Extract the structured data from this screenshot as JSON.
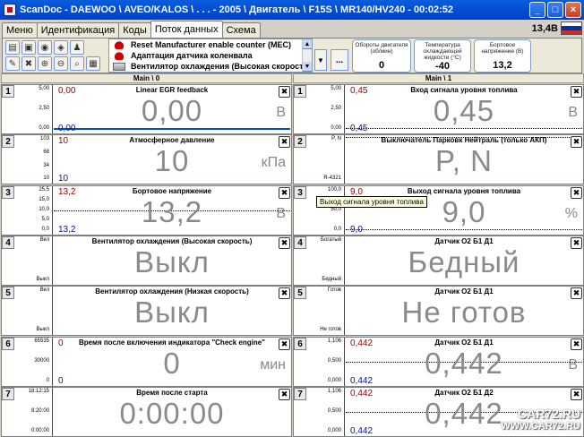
{
  "window": {
    "title": "ScanDoc - DAEWOO \\ AVEO/KALOS \\ . . . - 2005 \\ Двигатель \\ F15S \\ MR140/HV240 - 00:02:52",
    "min": "_",
    "max": "□",
    "close": "×"
  },
  "tabs": [
    {
      "label": "Меню",
      "active": false
    },
    {
      "label": "Идентификация",
      "active": false
    },
    {
      "label": "Коды",
      "active": false
    },
    {
      "label": "Поток данных",
      "active": true
    },
    {
      "label": "Схема",
      "active": false
    }
  ],
  "status": {
    "voltage": "13,4В",
    "flag_colors": [
      "#ffffff",
      "#0033a0",
      "#d52b1e"
    ]
  },
  "toolbar": {
    "params": [
      {
        "label": "Reset Manufacturer enable counter (MEC)",
        "icon": "red-car-icon"
      },
      {
        "label": "Адаптация датчика коленвала",
        "icon": "red-car-icon"
      },
      {
        "label": "Вентилятор охлаждения (Высокая скорость)",
        "icon": "grey-toggle-icon"
      }
    ],
    "dots": "...",
    "gauges": [
      {
        "label": "Обороты двигателя (об/мин)",
        "value": "0"
      },
      {
        "label": "Температура охлаждающей жидкости (°C)",
        "value": "-40"
      },
      {
        "label": "Бортовое напряжение (В)",
        "value": "13,2"
      }
    ]
  },
  "panes": [
    {
      "header": "Main \\ 0",
      "graphs": [
        {
          "num": "1",
          "title": "Linear EGR feedback",
          "value": "0,00",
          "unit": "В",
          "top": "0,00",
          "bottom": "0,00",
          "scale": [
            "5,00",
            "2,50",
            "0,00"
          ],
          "line": "solid-bottom"
        },
        {
          "num": "2",
          "title": "Атмосферное давление",
          "value": "10",
          "unit": "кПа",
          "top": "10",
          "bottom": "10",
          "scale": [
            "103",
            "68",
            "34",
            "10"
          ],
          "line": "none"
        },
        {
          "num": "3",
          "title": "Бортовое напряжение",
          "value": "13,2",
          "unit": "В",
          "top": "13,2",
          "bottom": "13,2",
          "scale": [
            "25,5",
            "15,0",
            "10,0",
            "5,0",
            "0,0"
          ],
          "line": "dotted-mid"
        },
        {
          "num": "4",
          "title": "Вентилятор охлаждения (Высокая скорость)",
          "value": "Выкл",
          "unit": "",
          "top": "",
          "bottom": "",
          "scale": [
            "Вкл",
            "Выкл"
          ],
          "line": "none"
        },
        {
          "num": "5",
          "title": "Вентилятор охлаждения (Низкая скорость)",
          "value": "Выкл",
          "unit": "",
          "top": "",
          "bottom": "",
          "scale": [
            "Вкл",
            "Выкл"
          ],
          "line": "none"
        },
        {
          "num": "6",
          "title": "Время после включения индикатора \"Check engine\"",
          "value": "0",
          "unit": "мин",
          "top": "0",
          "bottom": "0",
          "scale": [
            "65535",
            "30000",
            "0"
          ],
          "line": "none"
        },
        {
          "num": "7",
          "title": "Время после старта",
          "value": "0:00:00",
          "unit": "",
          "top": "",
          "bottom": "",
          "scale": [
            "18:12:15",
            "8:20:00",
            "0:00:00"
          ],
          "line": "none"
        }
      ]
    },
    {
      "header": "Main \\ 1",
      "graphs": [
        {
          "num": "1",
          "title": "Вход сигнала уровня топлива",
          "value": "0,45",
          "unit": "В",
          "top": "0,45",
          "bottom": "0,45",
          "scale": [
            "5,00",
            "2,50",
            "0,00"
          ],
          "line": "dotted-bottom"
        },
        {
          "num": "2",
          "title": "Выключатель Парковк Нейтраль (только АКП)",
          "value": "P, N",
          "unit": "",
          "top": "",
          "bottom": "",
          "scale": [
            "P, N",
            "R-4321"
          ],
          "line": "dotted-top"
        },
        {
          "num": "3",
          "title": "Выход сигнала уровня топлива",
          "value": "9,0",
          "unit": "%",
          "top": "9,0",
          "bottom": "9,0",
          "scale": [
            "100,0",
            "50,0",
            "0,0"
          ],
          "line": "dotted-bottom"
        },
        {
          "num": "4",
          "title": "Датчик О2 Б1 Д1",
          "value": "Бедный",
          "unit": "",
          "top": "",
          "bottom": "",
          "scale": [
            "Богатый",
            "Бедный"
          ],
          "line": "none"
        },
        {
          "num": "5",
          "title": "Датчик О2 Б1 Д1",
          "value": "Не готов",
          "unit": "",
          "top": "",
          "bottom": "",
          "scale": [
            "Готов",
            "Не готов"
          ],
          "line": "none"
        },
        {
          "num": "6",
          "title": "Датчик О2 Б1 Д1",
          "value": "0,442",
          "unit": "В",
          "top": "0,442",
          "bottom": "0,442",
          "scale": [
            "1,106",
            "0,500",
            "0,000"
          ],
          "line": "dotted-mid"
        },
        {
          "num": "7",
          "title": "Датчик О2 Б1 Д2",
          "value": "0,442",
          "unit": "",
          "top": "0,442",
          "bottom": "0,442",
          "scale": [
            "1,106",
            "0,500",
            "0,000"
          ],
          "line": "dotted-mid"
        }
      ]
    }
  ],
  "tooltip": "Выход сигнала уровня топлива",
  "watermark": {
    "line1": "CAR72.RU",
    "line2": "WWW.CAR72.RU"
  }
}
